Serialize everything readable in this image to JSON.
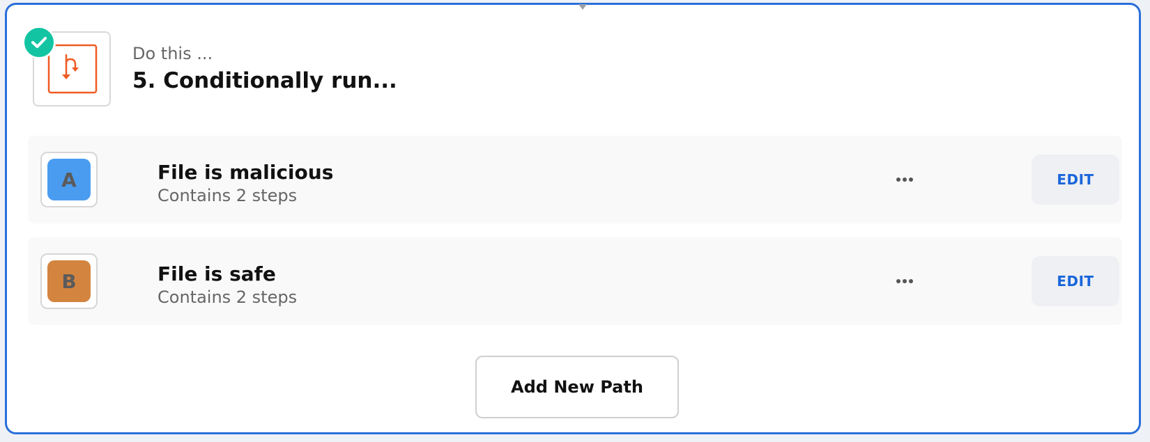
{
  "step": {
    "subtitle": "Do this ...",
    "title": "5. Conditionally run...",
    "icon": "paths-branch-icon",
    "status": "complete",
    "status_icon": "check-icon"
  },
  "paths": [
    {
      "letter": "A",
      "color": "#4a9cf0",
      "name": "File is malicious",
      "subtitle": "Contains 2 steps",
      "edit_label": "EDIT",
      "more_icon": "more-horizontal-icon"
    },
    {
      "letter": "B",
      "color": "#d3843f",
      "name": "File is safe",
      "subtitle": "Contains 2 steps",
      "edit_label": "EDIT",
      "more_icon": "more-horizontal-icon"
    }
  ],
  "add_path_label": "Add New Path",
  "colors": {
    "accent": "#2a6fdb",
    "success": "#13c4a3",
    "icon_orange": "#f05a22",
    "edit_text": "#1a66db"
  }
}
